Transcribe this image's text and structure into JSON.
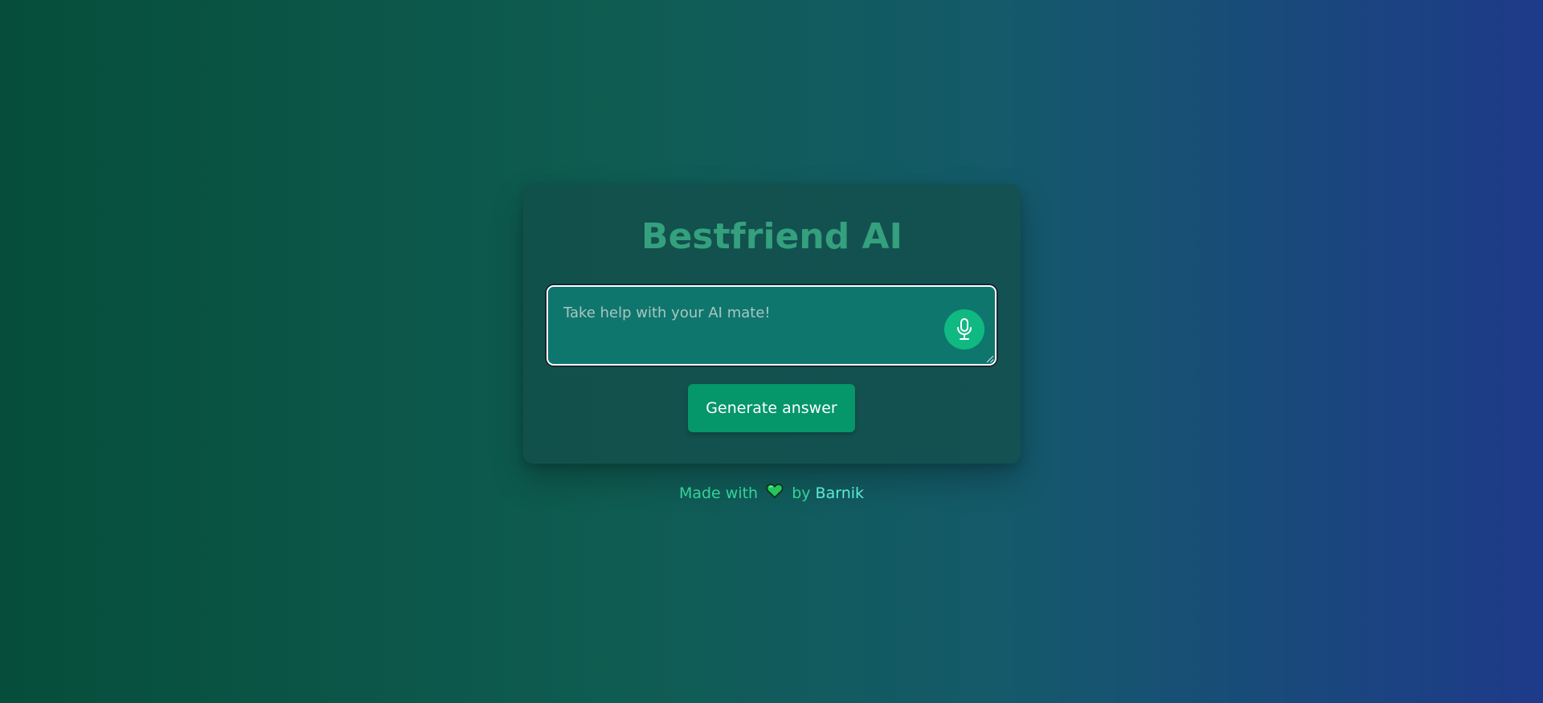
{
  "app": {
    "title": "Bestfriend AI"
  },
  "prompt": {
    "value": "",
    "placeholder": "Take help with your AI mate!"
  },
  "mic_button": {
    "icon": "microphone-icon"
  },
  "generate_button": {
    "label": "Generate answer"
  },
  "footer": {
    "prefix": "Made with",
    "heart_icon": "green-heart-icon",
    "by_text": "by",
    "author": "Barnik"
  },
  "colors": {
    "title": "#34a07d",
    "accent": "#10b981",
    "button": "#059669",
    "footer": "#34d399"
  }
}
